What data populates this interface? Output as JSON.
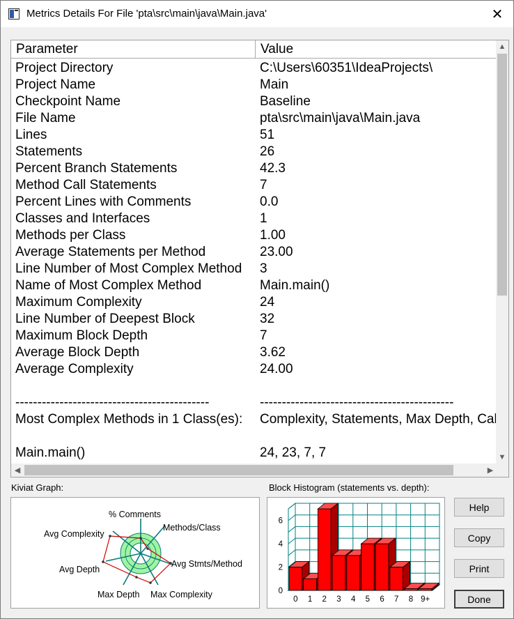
{
  "window": {
    "title": "Metrics Details For File 'pta\\src\\main\\java\\Main.java'",
    "close_glyph": "✕"
  },
  "table": {
    "columns": [
      "Parameter",
      "Value"
    ],
    "rows": [
      [
        "Project Directory",
        "C:\\Users\\60351\\IdeaProjects\\"
      ],
      [
        "Project Name",
        "Main"
      ],
      [
        "Checkpoint Name",
        "Baseline"
      ],
      [
        "File Name",
        "pta\\src\\main\\java\\Main.java"
      ],
      [
        "Lines",
        "51"
      ],
      [
        "Statements",
        "26"
      ],
      [
        "Percent Branch Statements",
        "42.3"
      ],
      [
        "Method Call Statements",
        "7"
      ],
      [
        "Percent Lines with Comments",
        "0.0"
      ],
      [
        "Classes and Interfaces",
        "1"
      ],
      [
        "Methods per Class",
        "1.00"
      ],
      [
        "Average Statements per Method",
        "23.00"
      ],
      [
        "Line Number of Most Complex Method",
        "3"
      ],
      [
        "Name of Most Complex Method",
        "Main.main()"
      ],
      [
        "Maximum Complexity",
        "24"
      ],
      [
        "Line Number of Deepest Block",
        "32"
      ],
      [
        "Maximum Block Depth",
        "7"
      ],
      [
        "Average Block Depth",
        "3.62"
      ],
      [
        "Average Complexity",
        "24.00"
      ],
      [
        "",
        ""
      ],
      [
        "--------------------------------------------",
        "--------------------------------------------"
      ],
      [
        "Most Complex Methods in 1 Class(es):",
        "Complexity, Statements, Max Depth, Calls"
      ],
      [
        "",
        ""
      ],
      [
        "Main.main()",
        "24, 23, 7, 7"
      ]
    ]
  },
  "scroll_arrows": {
    "up": "▲",
    "down": "▼",
    "left": "◀",
    "right": "▶"
  },
  "kiviat": {
    "label": "Kiviat Graph:",
    "axes": [
      "% Comments",
      "Methods/Class",
      "Avg Stmts/Method",
      "Max Complexity",
      "Max Depth",
      "Avg Depth",
      "Avg Complexity"
    ]
  },
  "histogram": {
    "label": "Block Histogram (statements vs. depth):",
    "categories": [
      "0",
      "1",
      "2",
      "3",
      "4",
      "5",
      "6",
      "7",
      "8",
      "9+"
    ],
    "values": [
      2,
      1,
      7,
      3,
      3,
      4,
      4,
      2,
      0,
      0
    ],
    "y_ticks": [
      "0",
      "2",
      "4",
      "6"
    ],
    "ylim": [
      0,
      7
    ]
  },
  "buttons": {
    "help": "Help",
    "copy": "Copy",
    "print": "Print",
    "done": "Done"
  },
  "colors": {
    "bar_front": "#ff0000",
    "bar_top": "#ff4d4d",
    "bar_side": "#a80000",
    "grid": "#008080",
    "kiviat_ring": "#9ff59f"
  }
}
